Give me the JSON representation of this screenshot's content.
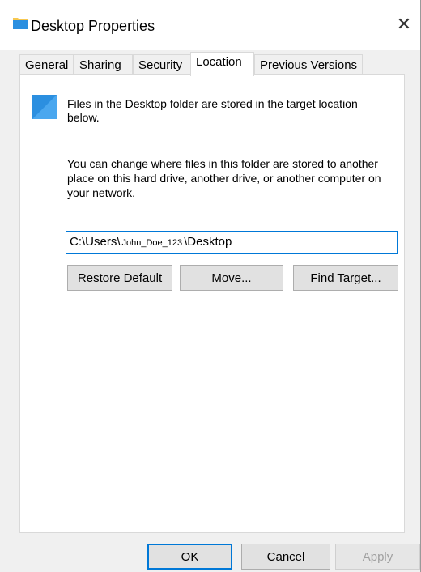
{
  "window": {
    "title": "Desktop Properties",
    "close_glyph": "✕"
  },
  "tabs": [
    {
      "label": "General"
    },
    {
      "label": "Sharing"
    },
    {
      "label": "Security"
    },
    {
      "label": "Location",
      "active": true
    },
    {
      "label": "Previous Versions"
    }
  ],
  "location": {
    "description": "Files in the Desktop folder are stored in the target location below.",
    "change_info": "You can change where files in this folder are stored to another place on this hard drive, another drive, or another computer on your network.",
    "path_prefix": "C:\\Users\\",
    "path_user": "John_Doe_123",
    "path_suffix": "\\Desktop",
    "restore_label": "Restore Default",
    "move_label": "Move...",
    "find_label": "Find Target..."
  },
  "footer": {
    "ok_label": "OK",
    "cancel_label": "Cancel",
    "apply_label": "Apply"
  },
  "colors": {
    "accent": "#0078d7",
    "folder_yellow": "#f7c850",
    "desktop_blue": "#2b8fe0"
  },
  "icons": {
    "title": "folder-icon",
    "desktop": "desktop-icon",
    "close": "close-icon"
  }
}
